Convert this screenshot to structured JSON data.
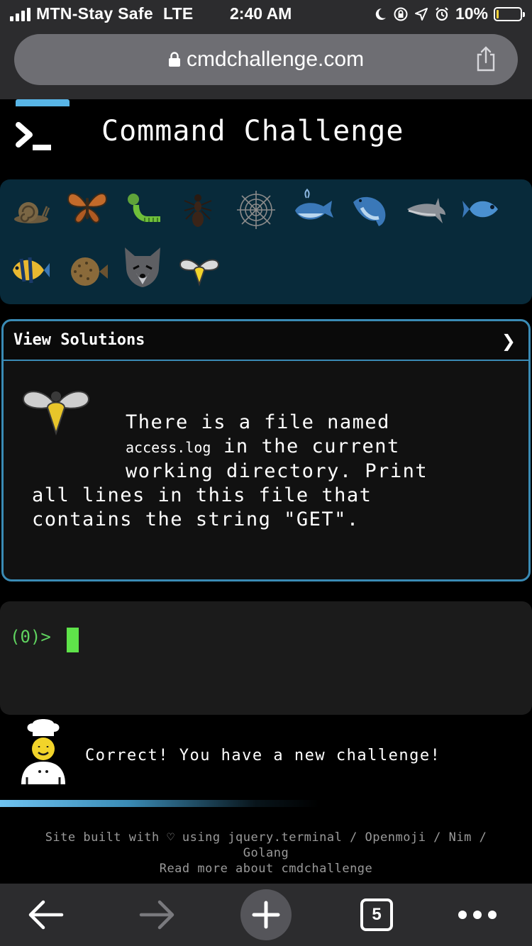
{
  "status_bar": {
    "carrier": "MTN-Stay Safe",
    "network": "LTE",
    "time": "2:40 AM",
    "battery_percent_label": "10%",
    "battery_level": 0.1,
    "icons": [
      "signal-icon",
      "moon-icon",
      "rotation-lock-icon",
      "location-icon",
      "alarm-icon",
      "battery-icon"
    ]
  },
  "browser": {
    "url": "cmdchallenge.com",
    "icons": [
      "lock-icon",
      "share-icon"
    ]
  },
  "header": {
    "title": "Command Challenge",
    "logo": "terminal-prompt-icon"
  },
  "emoji_row": {
    "items": [
      "snail",
      "butterfly",
      "caterpillar",
      "ant",
      "spider-web",
      "whale",
      "spouting-whale",
      "dolphin",
      "fish",
      "tropical-fish",
      "blowfish",
      "wolf",
      "bee"
    ]
  },
  "challenge": {
    "solutions_label": "View Solutions",
    "chevron": "❯",
    "text_line1": "There is a file named",
    "text_code": "access.log",
    "text_line2_rest": " in the current",
    "text_line3": "working directory. Print",
    "text_line4": "all lines in this file that",
    "text_line5": "contains the string \"GET\"."
  },
  "terminal": {
    "prompt": "(0)>"
  },
  "feedback": {
    "message": "Correct! You have a new challenge!"
  },
  "footer": {
    "line1": "Site built with ♡ using jquery.terminal / Openmoji / Nim /",
    "line2": "Golang",
    "line3": "Read more about cmdchallenge"
  },
  "toolbar": {
    "tab_count": "5",
    "icons": [
      "back-arrow-icon",
      "forward-arrow-icon",
      "new-tab-plus-icon",
      "tabs-icon",
      "more-icon"
    ]
  },
  "colors": {
    "accent": "#3a8bb5",
    "terminal_green": "#5fd35f",
    "panel_bg": "#082a3a"
  }
}
